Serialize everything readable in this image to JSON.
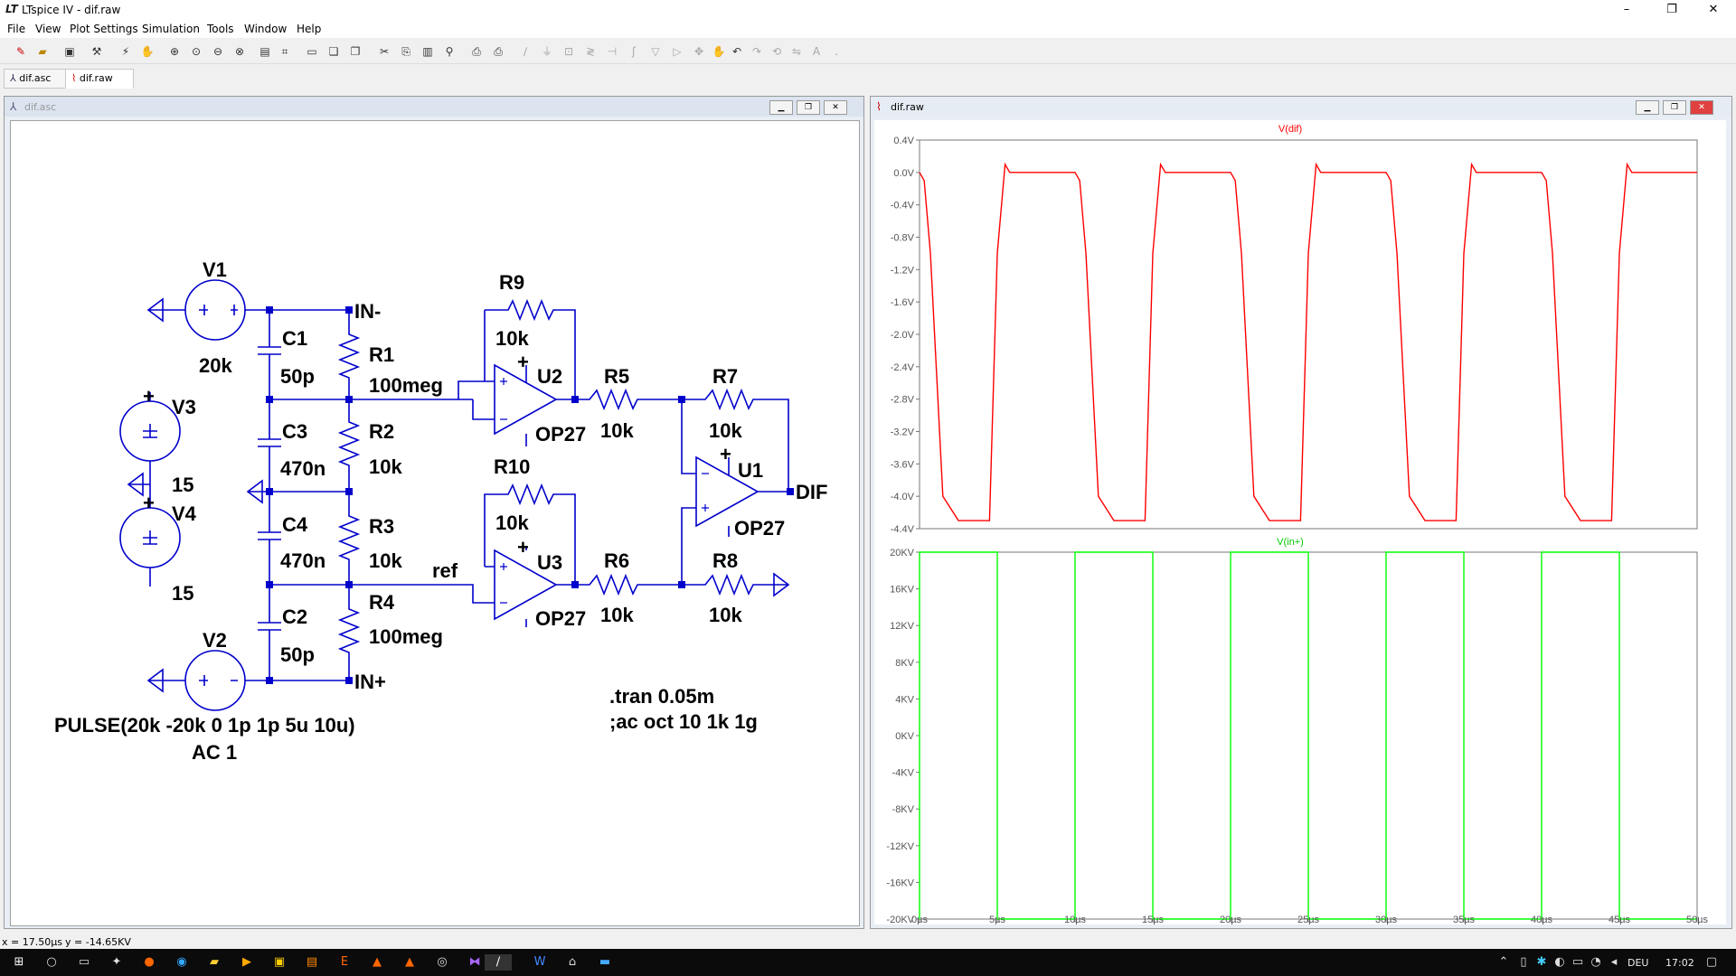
{
  "window": {
    "logo": "LT",
    "title": "LTspice IV - dif.raw",
    "minimize": "–",
    "maximize": "❐",
    "close": "✕"
  },
  "menu": [
    "File",
    "View",
    "Plot Settings",
    "Simulation",
    "Tools",
    "Window",
    "Help"
  ],
  "tabs": [
    {
      "label": "dif.asc",
      "icon": "schematic-icon"
    },
    {
      "label": "dif.raw",
      "icon": "waveform-icon"
    }
  ],
  "schematic_window": {
    "title": "dif.asc",
    "components": [
      {
        "ref": "V1",
        "value": "20k"
      },
      {
        "ref": "V2",
        "value": "PULSE(20k -20k 0 1p 1p 5u 10u)",
        "extra": "AC 1"
      },
      {
        "ref": "V3",
        "value": "15"
      },
      {
        "ref": "V4",
        "value": "15"
      },
      {
        "ref": "C1",
        "value": "50p"
      },
      {
        "ref": "C2",
        "value": "50p"
      },
      {
        "ref": "C3",
        "value": "470n"
      },
      {
        "ref": "C4",
        "value": "470n"
      },
      {
        "ref": "R1",
        "value": "100meg"
      },
      {
        "ref": "R2",
        "value": "10k"
      },
      {
        "ref": "R3",
        "value": "10k"
      },
      {
        "ref": "R4",
        "value": "100meg"
      },
      {
        "ref": "R5",
        "value": "10k"
      },
      {
        "ref": "R6",
        "value": "10k"
      },
      {
        "ref": "R7",
        "value": "10k"
      },
      {
        "ref": "R8",
        "value": "10k"
      },
      {
        "ref": "R9",
        "value": "10k"
      },
      {
        "ref": "R10",
        "value": "10k"
      },
      {
        "ref": "U1",
        "value": "OP27"
      },
      {
        "ref": "U2",
        "value": "OP27"
      },
      {
        "ref": "U3",
        "value": "OP27"
      }
    ],
    "net_labels": {
      "in_minus": "IN-",
      "in_plus": "IN+",
      "ref": "ref",
      "dif": "DIF"
    },
    "plus_sign": "+",
    "directives": [
      ".tran 0.05m",
      ";ac oct 10 1k 1g"
    ]
  },
  "plot_window": {
    "title": "dif.raw",
    "colors": {
      "trace1": "#ff0000",
      "trace2": "#00ff00",
      "bg": "#ffffff"
    }
  },
  "chart_data": [
    {
      "type": "line",
      "title": "V(dif)",
      "series": [
        {
          "name": "V(dif)",
          "x": [
            0,
            0.3,
            0.7,
            1.5,
            2.5,
            3.4,
            4.5,
            5.0,
            5.5,
            5.8,
            6.0,
            6.5,
            7.5,
            8.5,
            9.5,
            10.0
          ],
          "y": [
            0.0,
            -0.1,
            -1.0,
            -4.0,
            -4.3,
            -4.3,
            -4.3,
            -1.0,
            0.1,
            0.0,
            0.0,
            0.0,
            0.0,
            0.0,
            0.0,
            0.0
          ]
        }
      ],
      "period_us": 10,
      "xlim": [
        0,
        50
      ],
      "ylim": [
        -4.4,
        0.4
      ],
      "yticks": [
        "0.4V",
        "0.0V",
        "-0.4V",
        "-0.8V",
        "-1.2V",
        "-1.6V",
        "-2.0V",
        "-2.4V",
        "-2.8V",
        "-3.2V",
        "-3.6V",
        "-4.0V",
        "-4.4V"
      ],
      "ytick_values": [
        0.4,
        0.0,
        -0.4,
        -0.8,
        -1.2,
        -1.6,
        -2.0,
        -2.4,
        -2.8,
        -3.2,
        -3.6,
        -4.0,
        -4.4
      ]
    },
    {
      "type": "line",
      "title": "V(in+)",
      "series": [
        {
          "name": "V(in+)",
          "x": [
            0,
            0,
            5,
            5,
            10,
            10,
            15,
            15,
            20,
            20,
            25,
            25,
            30,
            30,
            35,
            35,
            40,
            40,
            45,
            45,
            50
          ],
          "y": [
            -20,
            20,
            20,
            -20,
            -20,
            20,
            20,
            -20,
            -20,
            20,
            20,
            -20,
            -20,
            20,
            20,
            -20,
            -20,
            20,
            20,
            -20,
            -20
          ]
        }
      ],
      "xlim": [
        0,
        50
      ],
      "ylim": [
        -20,
        20
      ],
      "yticks": [
        "20KV",
        "16KV",
        "12KV",
        "8KV",
        "4KV",
        "0KV",
        "-4KV",
        "-8KV",
        "-12KV",
        "-16KV",
        "-20KV"
      ],
      "ytick_values": [
        20,
        16,
        12,
        8,
        4,
        0,
        -4,
        -8,
        -12,
        -16,
        -20
      ],
      "xticks": [
        "0µs",
        "5µs",
        "10µs",
        "15µs",
        "20µs",
        "25µs",
        "30µs",
        "35µs",
        "40µs",
        "45µs",
        "50µs"
      ],
      "xtick_values": [
        0,
        5,
        10,
        15,
        20,
        25,
        30,
        35,
        40,
        45,
        50
      ]
    }
  ],
  "status": {
    "x": "x = 17.50µs",
    "y": "y = -14.65KV"
  },
  "tray": {
    "lang": "DEU",
    "time": "17:02"
  }
}
